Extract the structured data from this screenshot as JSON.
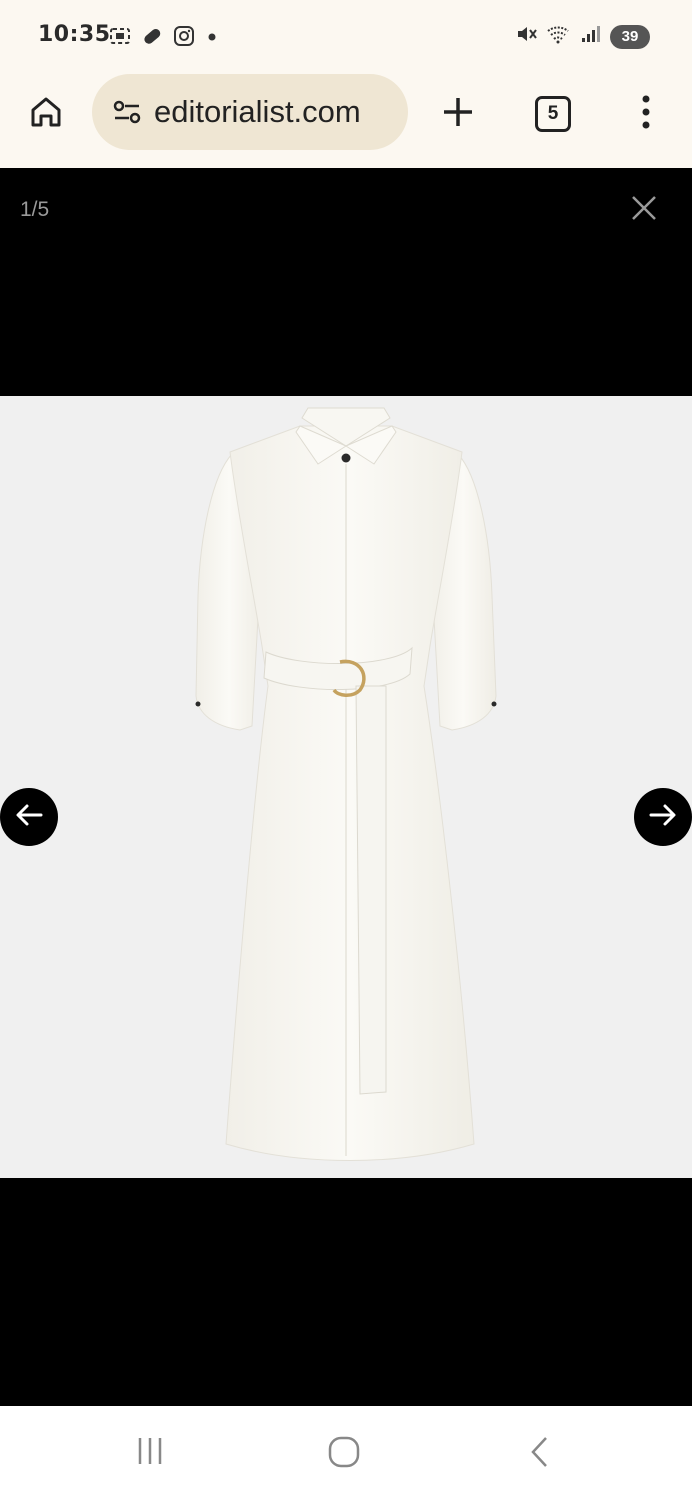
{
  "status_bar": {
    "time": "10:35",
    "battery": "39"
  },
  "browser": {
    "url": "editorialist.com",
    "tab_count": "5"
  },
  "viewer": {
    "counter": "1/5",
    "image_icon": "white-belted-shirt-dress",
    "background_color": "#000000",
    "image_background": "#f0f0f0"
  }
}
